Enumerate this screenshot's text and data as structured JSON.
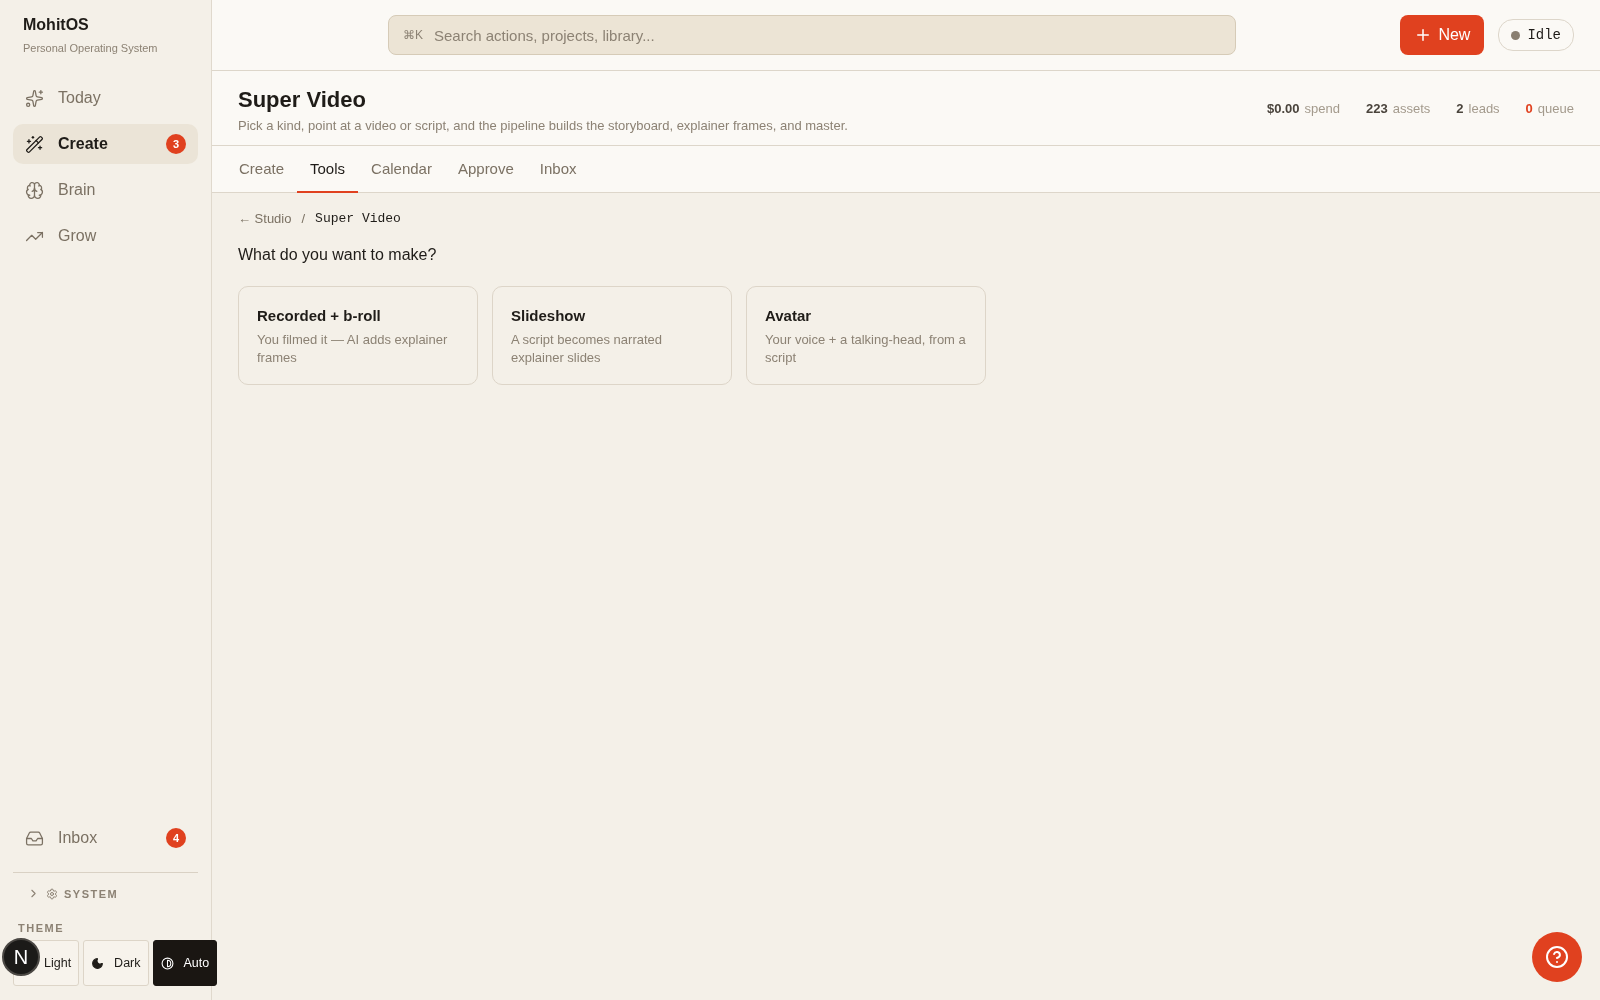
{
  "brand": {
    "name": "MohitOS",
    "tagline": "Personal Operating System"
  },
  "nav": [
    {
      "label": "Today",
      "selected": false
    },
    {
      "label": "Create",
      "selected": true,
      "badge": "3"
    },
    {
      "label": "Brain",
      "selected": false
    },
    {
      "label": "Grow",
      "selected": false
    }
  ],
  "nav_bottom": [
    {
      "label": "Inbox",
      "selected": false,
      "badge": "4"
    }
  ],
  "system": {
    "label": "SYSTEM",
    "expanded": false
  },
  "theme": {
    "label": "THEME",
    "options": [
      {
        "label": "Light",
        "selected": false
      },
      {
        "label": "Dark",
        "selected": false
      },
      {
        "label": "Auto",
        "selected": true
      }
    ]
  },
  "dev_badge": "N",
  "search": {
    "shortcut": "⌘K",
    "placeholder": "Search actions, projects, library..."
  },
  "new_button": "New",
  "status": {
    "label": "Idle"
  },
  "page": {
    "title": "Super Video",
    "subtitle": "Pick a kind, point at a video or script, and the pipeline builds the storyboard, explainer frames, and master."
  },
  "stats": [
    {
      "value": "$0.00",
      "label": "spend",
      "alert": false
    },
    {
      "value": "223",
      "label": "assets",
      "alert": false
    },
    {
      "value": "2",
      "label": "leads",
      "alert": false
    },
    {
      "value": "0",
      "label": "queue",
      "alert": true
    }
  ],
  "tabs": [
    {
      "label": "Create",
      "selected": false
    },
    {
      "label": "Tools",
      "selected": true
    },
    {
      "label": "Calendar",
      "selected": false
    },
    {
      "label": "Approve",
      "selected": false
    },
    {
      "label": "Inbox",
      "selected": false
    }
  ],
  "breadcrumb": {
    "back": "← Studio",
    "separator": "/",
    "current": "Super Video"
  },
  "question": "What do you want to make?",
  "kinds": [
    {
      "title": "Recorded + b-roll",
      "description": "You filmed it — AI adds explainer frames"
    },
    {
      "title": "Slideshow",
      "description": "A script becomes narrated explainer slides"
    },
    {
      "title": "Avatar",
      "description": "Your voice + a talking-head, from a script"
    }
  ]
}
